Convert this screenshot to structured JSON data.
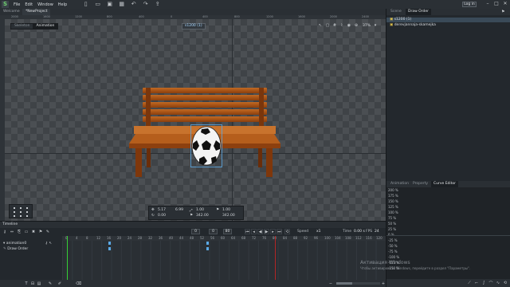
{
  "menubar": {
    "logo": "S",
    "items": [
      "File",
      "Edit",
      "Window",
      "Help"
    ],
    "login_label": "Log in",
    "toolbar_icons": [
      "new-file-icon",
      "open-folder-icon",
      "save-icon",
      "save-as-icon",
      "undo-icon",
      "redo-icon",
      "export-icon"
    ]
  },
  "doc_tabs": [
    "Welcome",
    "*NewProject"
  ],
  "viewport": {
    "modes": [
      "Skeleton",
      "Animation"
    ],
    "active_mode": "Animation",
    "selection_badge": "s1200 (1)",
    "zoom": "37%",
    "ruler_numbers": [
      "2000",
      "1600",
      "1200",
      "800",
      "400",
      "0",
      "400",
      "800",
      "1200",
      "1600",
      "2000",
      "2400"
    ]
  },
  "transform": {
    "pos_x": "5.17",
    "pos_y": "6.99",
    "rot": "0.00",
    "scale_x": "1.00",
    "scale_y": "1.00",
    "size_w": "342.00",
    "size_h": "342.00",
    "alt_x": "1.00"
  },
  "right_panel": {
    "tabs": [
      "Scene",
      "Draw Order"
    ],
    "active_tab": "Draw Order",
    "tree": [
      {
        "label": "s1200 (1)",
        "selected": true
      },
      {
        "label": "derevjannaja-skamejka",
        "selected": false
      }
    ],
    "curve_tabs": [
      "Animation",
      "Property",
      "Curve Editor"
    ],
    "curve_active": "Curve Editor",
    "pct_labels": [
      "200 %",
      "175 %",
      "150 %",
      "125 %",
      "100 %",
      "75 %",
      "50 %",
      "25 %",
      "0 %",
      "-25 %",
      "-50 %",
      "-75 %",
      "-100 %",
      "-125 %",
      "-150 %"
    ]
  },
  "timeline": {
    "title": "Timeline",
    "frame_current": "0",
    "frame_start": "0",
    "frame_end": "80",
    "speed_label": "Speed",
    "speed_value": "x1",
    "time_label": "Time",
    "time_value": "0.00 s",
    "fps_label": "FPS",
    "fps_value": "24",
    "tracks": [
      "animation0",
      "Draw Order"
    ],
    "ruler": [
      "0",
      "4",
      "8",
      "12",
      "16",
      "20",
      "24",
      "28",
      "32",
      "36",
      "40",
      "44",
      "48",
      "52",
      "56",
      "60",
      "64",
      "68",
      "72",
      "76",
      "80",
      "84",
      "88",
      "92",
      "96",
      "100",
      "104",
      "108",
      "112",
      "116",
      "120"
    ]
  },
  "watermark": {
    "line1": "Активация Windows",
    "line2": "Чтобы активировать Windows, перейдите в раздел \"Параметры\"."
  },
  "colors": {
    "playhead": "#35d035",
    "end_marker": "#b22626",
    "keyframe": "#5aa9e6",
    "selection": "#3a4a58"
  }
}
